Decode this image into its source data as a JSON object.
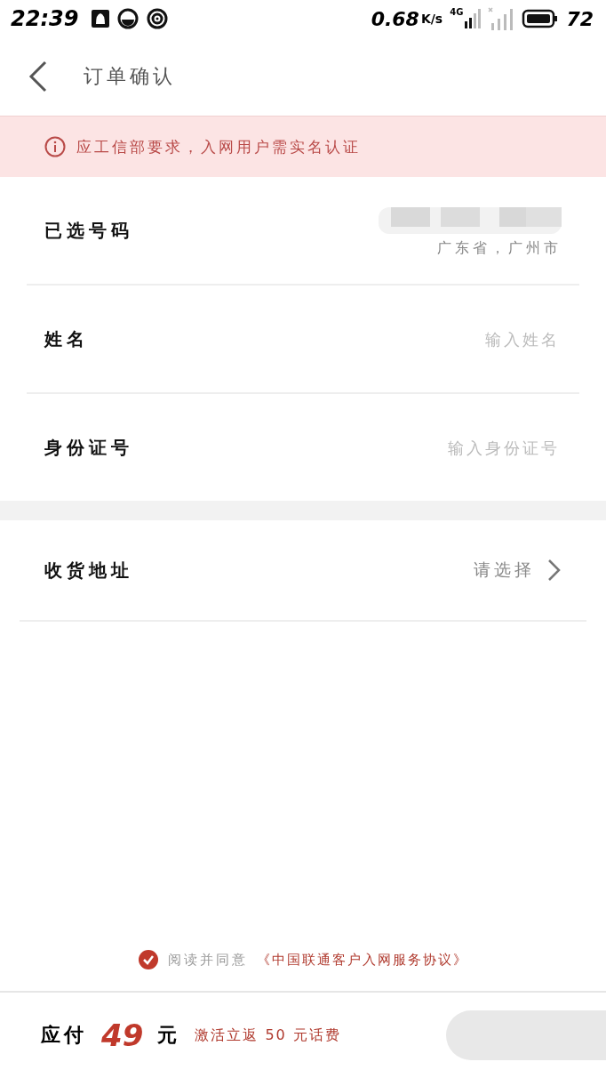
{
  "status_bar": {
    "time": "22:39",
    "speed": "0.68",
    "speed_unit": "K/s",
    "network": "4G",
    "battery": "72"
  },
  "header": {
    "title": "订单确认"
  },
  "notice": {
    "text": "应工信部要求，入网用户需实名认证"
  },
  "fields": [
    {
      "kind": "number",
      "label": "已选号码",
      "value": "广东省，广州市"
    },
    {
      "kind": "input",
      "label": "姓名",
      "placeholder": "输入姓名"
    },
    {
      "kind": "input",
      "label": "身份证号",
      "placeholder": "输入身份证号"
    }
  ],
  "address": {
    "label": "收货地址",
    "value": "请选择"
  },
  "agreement": {
    "checked": true,
    "text": "阅读并同意",
    "link": "《中国联通客户入网服务协议》"
  },
  "footer": {
    "label": "应付",
    "amount": "49",
    "unit": "元",
    "promo": "激活立返 50 元话费"
  }
}
